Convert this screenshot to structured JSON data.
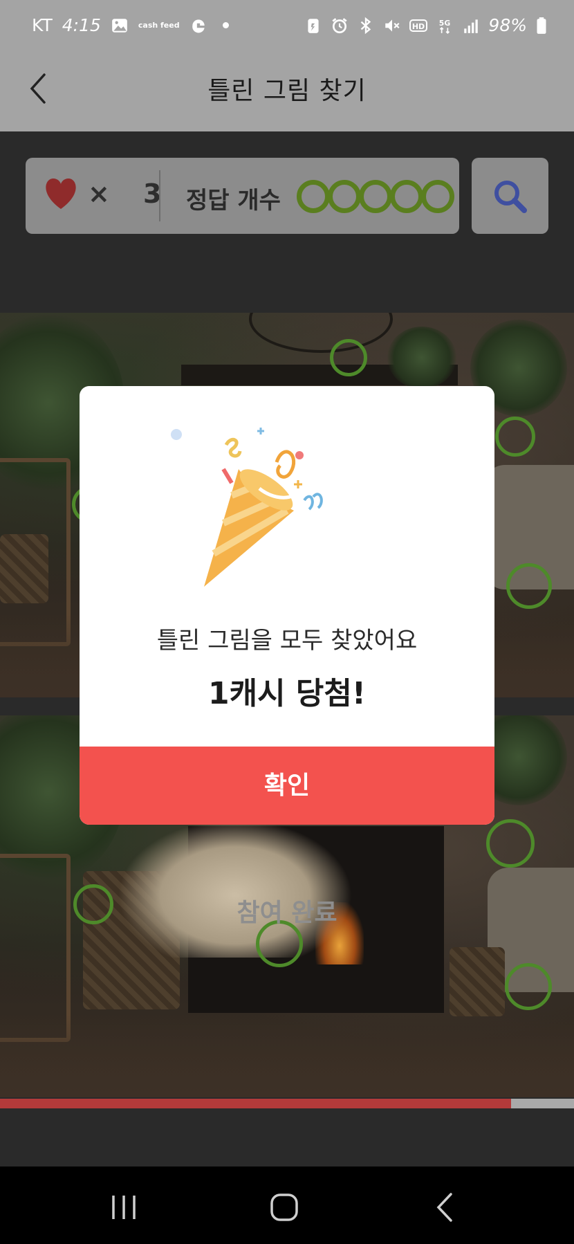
{
  "status_bar": {
    "carrier": "KT",
    "time": "4:15",
    "cashfeed_label": "cash feed",
    "battery": "98%"
  },
  "header": {
    "title": "틀린 그림 찾기"
  },
  "score": {
    "times_symbol": "×",
    "lives": "3",
    "answers_label": "정답 개수",
    "answers_found": 5,
    "answers_total": 5
  },
  "game": {
    "done_label": "참여 완료",
    "progress_fraction": 0.89,
    "circle_color": "#4e8a2a"
  },
  "dialog": {
    "message": "틀린 그림을 모두 찾았어요",
    "reward": "1캐시 당첨!",
    "confirm_label": "확인",
    "confirm_color": "#f3524e"
  },
  "icons": {
    "back": "chevron-left-icon",
    "hint": "search-icon",
    "heart": "heart-icon"
  }
}
